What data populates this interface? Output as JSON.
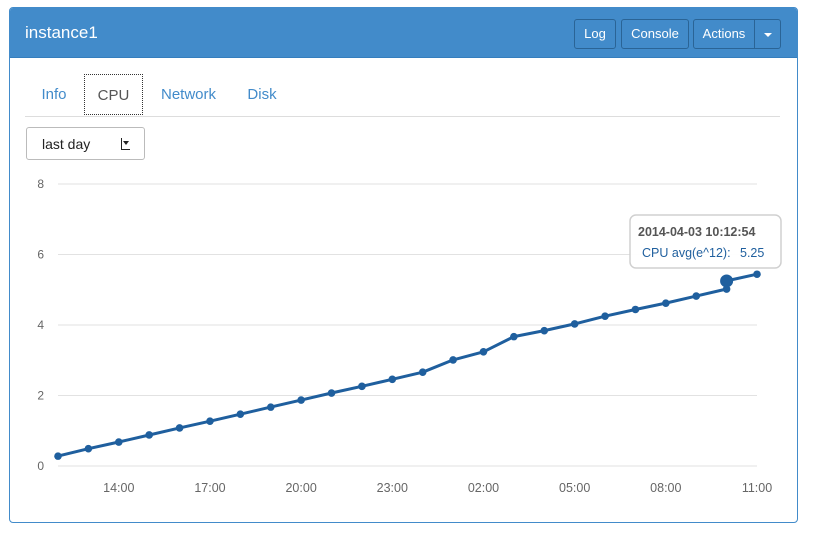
{
  "header": {
    "title": "instance1",
    "log_label": "Log",
    "console_label": "Console",
    "actions_label": "Actions"
  },
  "tabs": [
    {
      "label": "Info",
      "active": false
    },
    {
      "label": "CPU",
      "active": true
    },
    {
      "label": "Network",
      "active": false
    },
    {
      "label": "Disk",
      "active": false
    }
  ],
  "range_select": {
    "value": "last day"
  },
  "tooltip": {
    "timestamp": "2014-04-03 10:12:54",
    "series_label": "CPU avg(e^12):",
    "value_text": "5.25"
  },
  "colors": {
    "accent": "#428bca",
    "series": "#1f5f9e"
  },
  "chart_data": {
    "type": "line",
    "title": "",
    "xlabel": "",
    "ylabel": "",
    "ylim": [
      0,
      8
    ],
    "yticks": [
      0,
      2,
      4,
      6,
      8
    ],
    "xlim": [
      12,
      35
    ],
    "xticks": [
      {
        "value": 14,
        "label": "14:00"
      },
      {
        "value": 17,
        "label": "17:00"
      },
      {
        "value": 20,
        "label": "20:00"
      },
      {
        "value": 23,
        "label": "23:00"
      },
      {
        "value": 26,
        "label": "02:00"
      },
      {
        "value": 29,
        "label": "05:00"
      },
      {
        "value": 32,
        "label": "08:00"
      },
      {
        "value": 35,
        "label": "11:00"
      }
    ],
    "grid": true,
    "highlight_index": 24,
    "series": [
      {
        "x": [
          12.0,
          13.0,
          14.0,
          15.0,
          16.0,
          17.0,
          18.0,
          19.0,
          20.0,
          21.0,
          22.0,
          23.0,
          24.0,
          25.0,
          26.0,
          27.0,
          28.0,
          29.0,
          30.0,
          31.0,
          32.0,
          33.0,
          34.0,
          34.2,
          34.0,
          35.0
        ],
        "y": [
          0.28,
          0.49,
          0.68,
          0.88,
          1.08,
          1.27,
          1.47,
          1.67,
          1.87,
          2.07,
          2.26,
          2.46,
          2.66,
          3.01,
          3.24,
          3.67,
          3.84,
          4.03,
          4.25,
          4.44,
          4.62,
          4.82,
          5.02,
          5.02,
          5.25,
          5.44
        ]
      }
    ]
  }
}
